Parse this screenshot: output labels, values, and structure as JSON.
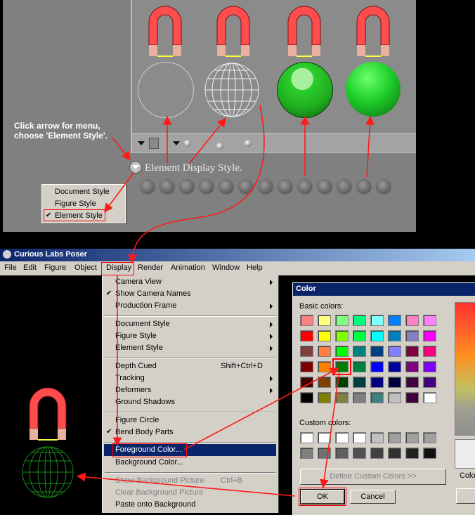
{
  "top_panel": {
    "hint": "Click arrow for menu, choose 'Element Style'.",
    "label": "Element Display Style.",
    "popup_items": [
      "Document Style",
      "Figure Style",
      "Element Style"
    ],
    "popup_checked": "Element Style"
  },
  "window": {
    "title": "Curious Labs Poser"
  },
  "menubar": [
    "File",
    "Edit",
    "Figure",
    "Object",
    "Display",
    "Render",
    "Animation",
    "Window",
    "Help"
  ],
  "display_menu": {
    "camera_view": "Camera View",
    "show_camera_names": "Show Camera Names",
    "production_frame": "Production Frame",
    "document_style": "Document Style",
    "figure_style": "Figure Style",
    "element_style": "Element Style",
    "depth_cued": "Depth Cued",
    "depth_cued_shortcut": "Shift+Ctrl+D",
    "tracking": "Tracking",
    "deformers": "Deformers",
    "ground_shadows": "Ground Shadows",
    "figure_circle": "Figure Circle",
    "bend_body_parts": "Bend Body Parts",
    "foreground_color": "Foreground Color...",
    "background_color": "Background Color...",
    "show_background_picture": "Show Background Picture",
    "show_background_shortcut": "Ctrl+B",
    "clear_background_picture": "Clear Background Picture",
    "paste_onto_background": "Paste onto Background"
  },
  "color_dialog": {
    "title": "Color",
    "basic_label": "Basic colors:",
    "custom_label": "Custom colors:",
    "define_button": "Define Custom Colors >>",
    "ok_button": "OK",
    "cancel_button": "Cancel",
    "color_label": "Colo",
    "basic_colors": [
      [
        "#ff8080",
        "#ffff80",
        "#80ff80",
        "#00ff80",
        "#80ffff",
        "#0080ff",
        "#ff80c0",
        "#ff80ff"
      ],
      [
        "#ff0000",
        "#ffff00",
        "#80ff00",
        "#00ff40",
        "#00ffff",
        "#0080c0",
        "#8080c0",
        "#ff00ff"
      ],
      [
        "#804040",
        "#ff8040",
        "#00ff00",
        "#008080",
        "#004080",
        "#8080ff",
        "#800040",
        "#ff0080"
      ],
      [
        "#800000",
        "#ff8000",
        "#008000",
        "#008040",
        "#0000ff",
        "#0000a0",
        "#800080",
        "#8000ff"
      ],
      [
        "#400000",
        "#804000",
        "#004000",
        "#004040",
        "#000080",
        "#000040",
        "#400040",
        "#400080"
      ],
      [
        "#000000",
        "#808000",
        "#808040",
        "#808080",
        "#408080",
        "#c0c0c0",
        "#400040",
        "#ffffff"
      ]
    ],
    "custom_colors": [
      [
        "#ffffff",
        "#ffffff",
        "#ffffff",
        "#ffffff",
        "#c0c0c0",
        "#a0a0a0",
        "#a0a0a0",
        "#a0a0a0"
      ],
      [
        "#808080",
        "#707070",
        "#606060",
        "#505050",
        "#404040",
        "#303030",
        "#202020",
        "#101010"
      ]
    ],
    "selected": [
      3,
      2
    ]
  },
  "colors": {
    "accent": "#0a246a",
    "highlight_box": "#ff0000",
    "selected_ball": "#1fd02a",
    "wire_green": "#1a8a1a",
    "magnet_red": "#ff4d4d"
  }
}
